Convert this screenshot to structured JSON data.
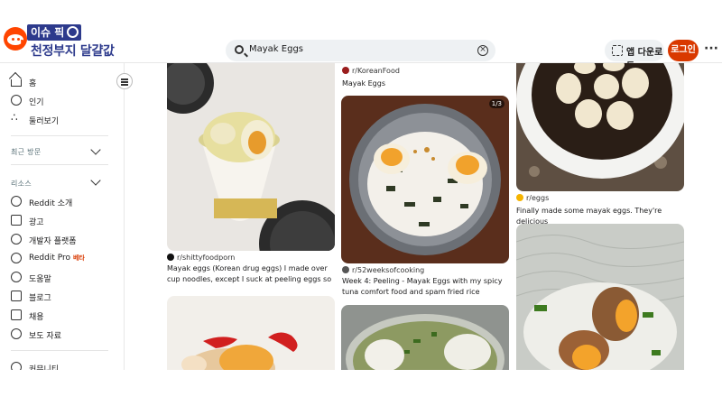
{
  "banner": {
    "tag": "이슈 픽",
    "title": "천정부지 달걀값",
    "logo_letter": "r"
  },
  "search": {
    "value": "Mayak Eggs"
  },
  "header": {
    "app_download": "앱 다운로드",
    "login": "로그인",
    "more": "···"
  },
  "sidebar": {
    "items": [
      {
        "label": "홈",
        "icon": "home-icon"
      },
      {
        "label": "인기",
        "icon": "popular-icon"
      },
      {
        "label": "둘러보기",
        "icon": "explore-icon"
      }
    ],
    "recent_label": "최근 방문",
    "resources_label": "리소스",
    "resources": [
      {
        "label": "Reddit 소개",
        "icon": "reddit-about-icon"
      },
      {
        "label": "광고",
        "icon": "megaphone-icon"
      },
      {
        "label": "개발자 플랫폼",
        "icon": "developer-icon"
      },
      {
        "label": "Reddit Pro",
        "icon": "pro-icon",
        "badge": "베타"
      },
      {
        "label": "도움말",
        "icon": "help-icon"
      },
      {
        "label": "블로그",
        "icon": "blog-icon"
      },
      {
        "label": "채용",
        "icon": "careers-icon"
      },
      {
        "label": "보도 자료",
        "icon": "press-icon"
      }
    ],
    "communities_label": "커뮤니티"
  },
  "feed": {
    "col1": [
      {
        "subreddit": "r/shittyfoodporn",
        "title": "Mayak eggs (Korean drug eggs) I made over cup noodles, except I suck at peeling eggs so one is..."
      }
    ],
    "col2": [
      {
        "subreddit": "r/KoreanFood",
        "title": "Mayak Eggs"
      },
      {
        "subreddit": "r/52weeksofcooking",
        "title": "Week 4: Peeling - Mayak Eggs with my spicy tuna comfort food and spam fried rice",
        "badge": "1/3"
      }
    ],
    "col3": [
      {
        "subreddit": "r/eggs",
        "title": "Finally made some mayak eggs. They're delicious"
      }
    ]
  },
  "colors": {
    "accent": "#d93900",
    "brand": "#ff4500",
    "banner": "#2d3a8c"
  }
}
